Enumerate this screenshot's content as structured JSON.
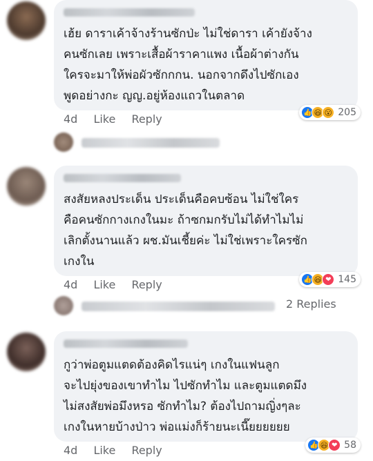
{
  "comments": [
    {
      "text": "เฮ้ย ดาราเค้าจ้างร้านซักป่ะ ไม่ใช่ดารา เค้ายังจ้าง\nคนซักเลย เพราะเสื้อผ้าราคาแพง เนื้อผ้าต่างกัน\nใครจะมาให้พ่อผัวซักกกน. นอกจากดึงไปซักเอง\nพูดอย่างกะ ญญ.อยู่ห้องแถวในตลาด",
      "time": "4d",
      "like": "Like",
      "reply": "Reply",
      "reaction_count": "205",
      "reactions": [
        "like",
        "haha",
        "wow"
      ]
    },
    {
      "text": "สงสัยหลงประเด็น ประเด็นคือคบซ้อน ไม่ใช่ใคร\nคือคนซักกางเกงในมะ ถ้าซกมกรับไม่ได้ทำไมไม่\nเลิกตั้งนานแล้ว ผช.มันเชี้ยค่ะ ไม่ใช่เพราะใครซัก\nเกงใน",
      "time": "4d",
      "like": "Like",
      "reply": "Reply",
      "reaction_count": "145",
      "reactions": [
        "like",
        "haha",
        "love"
      ],
      "replies_label": "2 Replies"
    },
    {
      "text": "กูว่าพ่อตูมแตดต้องคิดไรแน่ๆ เกงในแฟนลูก\nจะไปยุ่งของเขาทำไม ไปซักทำไม และตูมแตดมึง\nไม่สงสัยพ่อมึงหรอ ซักทำไม? ต้องไปถามญิ่งๆละ\nเกงในหายบ้างป่าว พ่อแม่งก็ร้ายนะเนี๊ยยยยยย",
      "time": "4d",
      "like": "Like",
      "reply": "Reply",
      "reaction_count": "58",
      "reactions": [
        "like",
        "haha",
        "love"
      ]
    }
  ],
  "icons": {
    "like": "thumbs-up-icon",
    "haha": "laughing-face-icon",
    "wow": "surprised-face-icon",
    "love": "heart-icon"
  },
  "colors": {
    "like": "#1877f2",
    "haha": "#f7b125",
    "love": "#f33e58",
    "bubble": "#f0f2f5",
    "meta": "#65676b"
  }
}
